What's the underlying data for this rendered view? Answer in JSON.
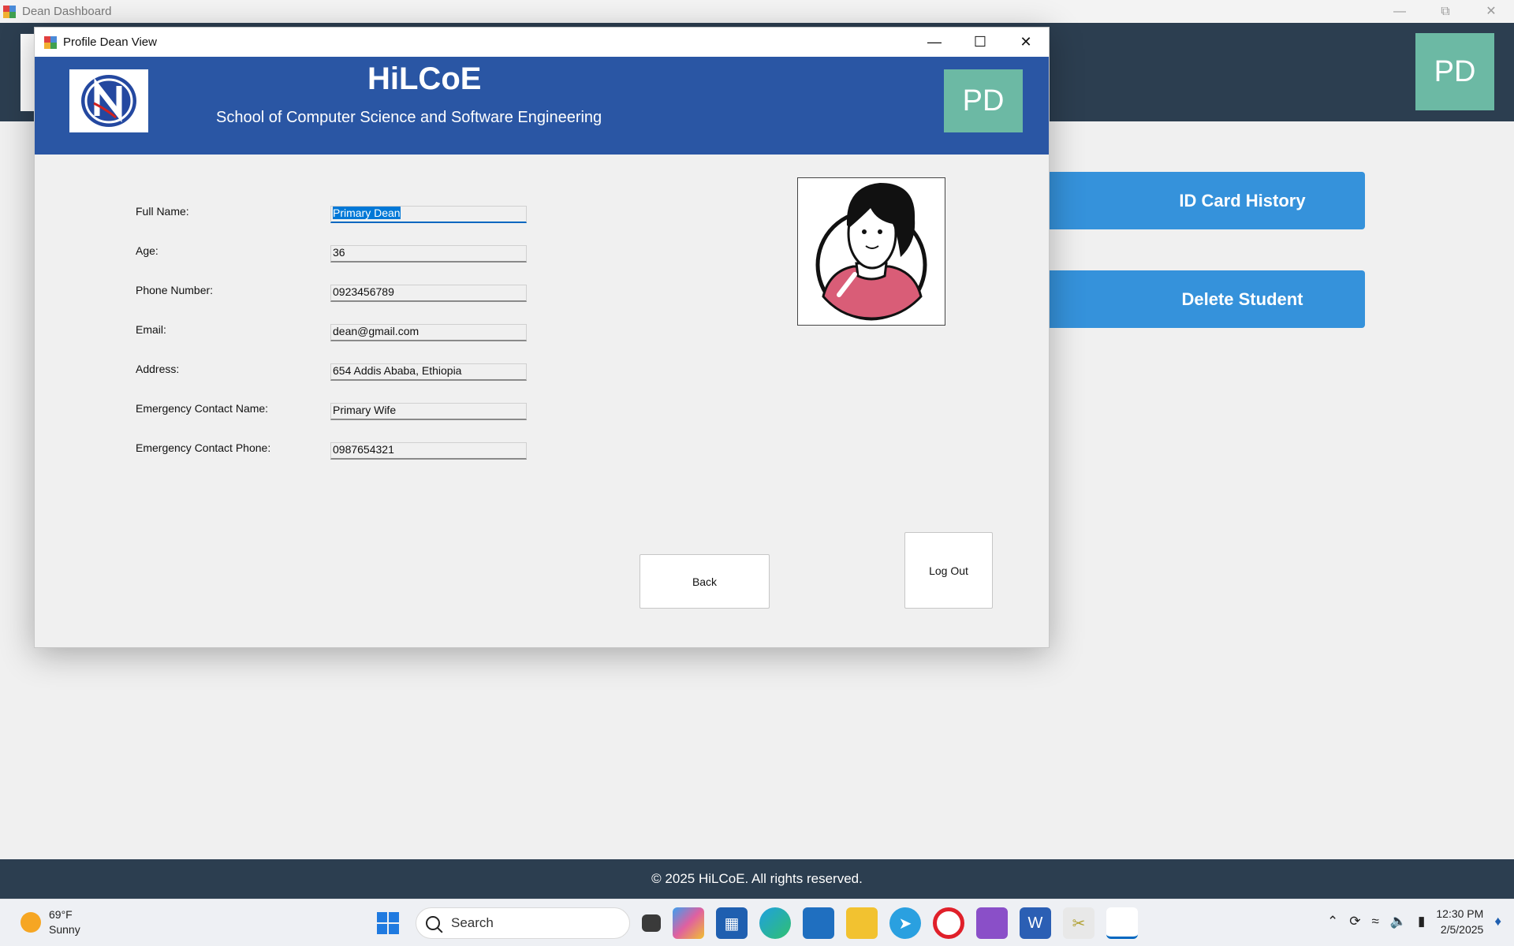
{
  "main_window": {
    "title": "Dean Dashboard",
    "avatar_initials": "PD",
    "side_buttons": [
      "ID Card History",
      "Delete Student"
    ],
    "footer": "© 2025 HiLCoE. All rights reserved."
  },
  "dialog": {
    "title": "Profile Dean View",
    "header": {
      "title": "HiLCoE",
      "subtitle": "School of Computer Science and Software Engineering",
      "avatar_initials": "PD"
    },
    "fields": [
      {
        "label": "Full Name:",
        "value": "Primary Dean"
      },
      {
        "label": "Age:",
        "value": "36"
      },
      {
        "label": "Phone Number:",
        "value": "0923456789"
      },
      {
        "label": "Email:",
        "value": "dean@gmail.com"
      },
      {
        "label": "Address:",
        "value": "654 Addis Ababa, Ethiopia"
      },
      {
        "label": "Emergency Contact Name:",
        "value": "Primary Wife"
      },
      {
        "label": "Emergency Contact Phone:",
        "value": "0987654321"
      }
    ],
    "buttons": {
      "back": "Back",
      "logout": "Log Out"
    }
  },
  "taskbar": {
    "weather_temp": "69°F",
    "weather_desc": "Sunny",
    "search_placeholder": "Search",
    "time": "12:30 PM",
    "date": "2/5/2025"
  }
}
